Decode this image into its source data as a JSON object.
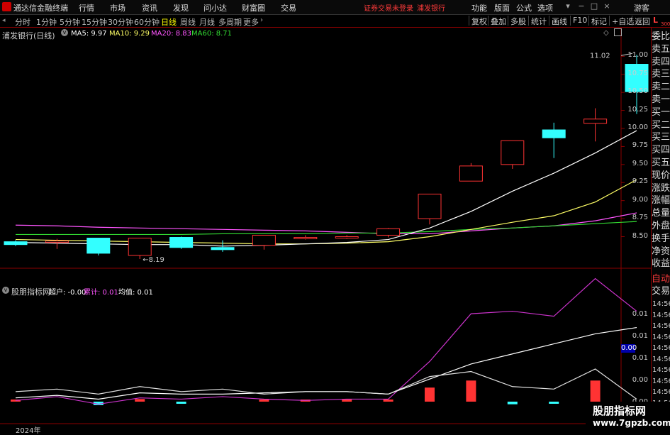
{
  "titlebar": {
    "app_name": "通达信金融终端",
    "menus": [
      "行情",
      "市场",
      "资讯",
      "发现",
      "问小达",
      "财富圈",
      "交易"
    ],
    "warning": "证券交易未登录",
    "stock": "浦发银行",
    "right_menus": [
      "功能",
      "版面",
      "公式",
      "选项"
    ],
    "guest": "游客"
  },
  "periodbar": {
    "periods": [
      "分时",
      "1分钟",
      "5分钟",
      "15分钟",
      "30分钟",
      "60分钟",
      "日线",
      "周线",
      "月线",
      "多周期",
      "更多"
    ],
    "active": "日线",
    "tools": [
      "复权",
      "叠加",
      "多股",
      "统计",
      "画线",
      "F10",
      "标记",
      "+自选",
      "返回"
    ]
  },
  "main_legend": {
    "title": "浦发银行(日线)",
    "ma5": "MA5: 9.97",
    "ma10": "MA10: 9.29",
    "ma20": "MA20: 8.83",
    "ma60": "MA60: 8.71",
    "colors": {
      "ma5": "#ffffff",
      "ma10": "#ffff66",
      "ma20": "#ff55ff",
      "ma60": "#33dd33",
      "up": "#ff3333",
      "down": "#33ffff"
    }
  },
  "sub_legend": {
    "title": "股朋指标网",
    "chaohu": "超户: -0.00",
    "leiji": "累计: 0.01",
    "junzhi": "均值: 0.01"
  },
  "sidebar": [
    "委比",
    "卖五",
    "卖四",
    "卖三",
    "卖二",
    "卖一",
    "买一",
    "买二",
    "买三",
    "买四",
    "买五",
    "现价",
    "涨跌",
    "涨幅",
    "总量",
    "外盘",
    "换手",
    "净资",
    "收益"
  ],
  "sidebar_tabs": [
    "自动",
    "交易"
  ],
  "sidebar_corner": {
    "l": "L",
    "n": "300"
  },
  "sub_axis_labels": [
    "0.01",
    "0.01",
    "0.01",
    "0.00",
    "0.00"
  ],
  "sub_axis_highlight": "0.00",
  "time_labels": [
    "14:56",
    "14:56",
    "14:56",
    "14:56",
    "14:56",
    "14:56",
    "14:56",
    "14:56",
    "14:56",
    "14:56"
  ],
  "date_label": "2024年",
  "watermark": {
    "line1": "股朋指标网",
    "line2": "www.7gpzb.com"
  },
  "chart_data": {
    "type": "candlestick",
    "yticks": [
      11.0,
      10.75,
      10.5,
      10.25,
      10.0,
      9.75,
      9.5,
      9.25,
      9.0,
      8.75,
      8.5
    ],
    "ylim": [
      8.2,
      11.2
    ],
    "candles": [
      {
        "open": 8.43,
        "close": 8.39,
        "high": 8.45,
        "low": 8.37
      },
      {
        "open": 8.42,
        "close": 8.44,
        "high": 8.47,
        "low": 8.33
      },
      {
        "open": 8.48,
        "close": 8.27,
        "high": 8.48,
        "low": 8.24
      },
      {
        "open": 8.24,
        "close": 8.48,
        "high": 8.48,
        "low": 8.19
      },
      {
        "open": 8.49,
        "close": 8.35,
        "high": 8.5,
        "low": 8.33
      },
      {
        "open": 8.35,
        "close": 8.32,
        "high": 8.45,
        "low": 8.29
      },
      {
        "open": 8.38,
        "close": 8.52,
        "high": 8.52,
        "low": 8.32
      },
      {
        "open": 8.47,
        "close": 8.49,
        "high": 8.52,
        "low": 8.46
      },
      {
        "open": 8.49,
        "close": 8.5,
        "high": 8.52,
        "low": 8.47
      },
      {
        "open": 8.52,
        "close": 8.61,
        "high": 8.62,
        "low": 8.49
      },
      {
        "open": 8.75,
        "close": 9.09,
        "high": 9.09,
        "low": 8.67
      },
      {
        "open": 9.27,
        "close": 9.48,
        "high": 9.52,
        "low": 9.27
      },
      {
        "open": 9.5,
        "close": 9.83,
        "high": 9.83,
        "low": 9.44
      },
      {
        "open": 9.98,
        "close": 9.87,
        "high": 10.08,
        "low": 9.59
      },
      {
        "open": 10.07,
        "close": 10.13,
        "high": 10.28,
        "low": 9.82
      },
      {
        "open": 10.89,
        "close": 10.51,
        "high": 11.02,
        "low": 10.2
      }
    ],
    "annotations": [
      {
        "label": "11.02"
      },
      {
        "label": "8.19"
      }
    ],
    "ma5": [
      8.42,
      8.41,
      8.4,
      8.39,
      8.39,
      8.37,
      8.38,
      8.4,
      8.42,
      8.46,
      8.62,
      8.85,
      9.13,
      9.38,
      9.66,
      9.97
    ],
    "ma10": [
      8.46,
      8.45,
      8.44,
      8.43,
      8.42,
      8.41,
      8.4,
      8.4,
      8.41,
      8.43,
      8.5,
      8.6,
      8.7,
      8.79,
      8.98,
      9.29
    ],
    "ma20": [
      8.66,
      8.65,
      8.63,
      8.62,
      8.61,
      8.6,
      8.59,
      8.58,
      8.56,
      8.54,
      8.54,
      8.58,
      8.62,
      8.65,
      8.72,
      8.83
    ],
    "ma60": [
      8.53,
      8.53,
      8.53,
      8.53,
      8.53,
      8.54,
      8.54,
      8.54,
      8.55,
      8.55,
      8.57,
      8.6,
      8.62,
      8.65,
      8.68,
      8.71
    ]
  },
  "sub_chart_data": {
    "type": "bar-line",
    "bars": [
      0.1,
      0,
      -0.2,
      0.15,
      -0.1,
      0,
      0.1,
      0.05,
      0.05,
      0.1,
      0.8,
      1.2,
      -0.15,
      -0.1,
      1.2,
      0
    ],
    "line_purple": [
      0.05,
      0.2,
      -0.1,
      0.15,
      0.1,
      0.2,
      0.1,
      0.05,
      0.1,
      0.1,
      1.6,
      3.5,
      3.6,
      3.4,
      4.9,
      3.6
    ],
    "line_white": [
      0.15,
      0.25,
      0.1,
      0.35,
      0.3,
      0.3,
      0.35,
      0.4,
      0.4,
      0.3,
      0.9,
      1.5,
      1.9,
      2.3,
      2.7,
      2.95
    ],
    "line_white2": [
      0.4,
      0.5,
      0.3,
      0.6,
      0.4,
      0.5,
      0.3,
      0.4,
      0.4,
      0.3,
      1.0,
      1.2,
      0.6,
      0.5,
      1.3,
      0.1
    ]
  }
}
